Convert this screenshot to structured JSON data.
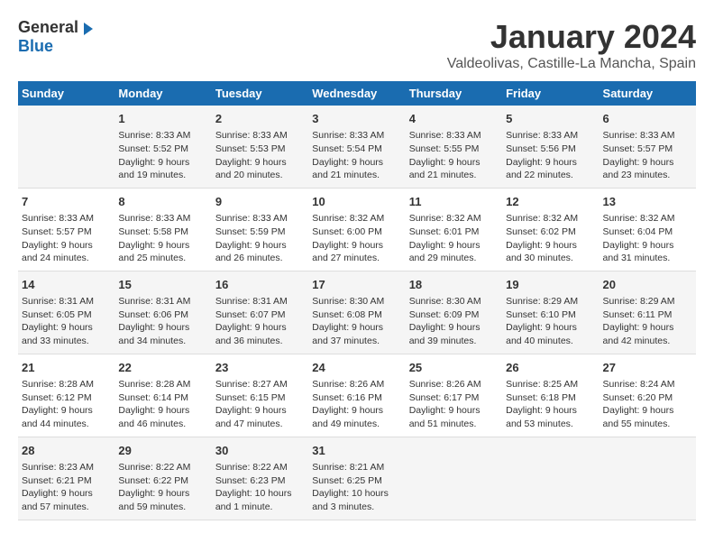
{
  "header": {
    "logo_general": "General",
    "logo_blue": "Blue",
    "month": "January 2024",
    "location": "Valdeolivas, Castille-La Mancha, Spain"
  },
  "days_of_week": [
    "Sunday",
    "Monday",
    "Tuesday",
    "Wednesday",
    "Thursday",
    "Friday",
    "Saturday"
  ],
  "weeks": [
    [
      {
        "day": "",
        "info": ""
      },
      {
        "day": "1",
        "info": "Sunrise: 8:33 AM\nSunset: 5:52 PM\nDaylight: 9 hours\nand 19 minutes."
      },
      {
        "day": "2",
        "info": "Sunrise: 8:33 AM\nSunset: 5:53 PM\nDaylight: 9 hours\nand 20 minutes."
      },
      {
        "day": "3",
        "info": "Sunrise: 8:33 AM\nSunset: 5:54 PM\nDaylight: 9 hours\nand 21 minutes."
      },
      {
        "day": "4",
        "info": "Sunrise: 8:33 AM\nSunset: 5:55 PM\nDaylight: 9 hours\nand 21 minutes."
      },
      {
        "day": "5",
        "info": "Sunrise: 8:33 AM\nSunset: 5:56 PM\nDaylight: 9 hours\nand 22 minutes."
      },
      {
        "day": "6",
        "info": "Sunrise: 8:33 AM\nSunset: 5:57 PM\nDaylight: 9 hours\nand 23 minutes."
      }
    ],
    [
      {
        "day": "7",
        "info": "Sunrise: 8:33 AM\nSunset: 5:57 PM\nDaylight: 9 hours\nand 24 minutes."
      },
      {
        "day": "8",
        "info": "Sunrise: 8:33 AM\nSunset: 5:58 PM\nDaylight: 9 hours\nand 25 minutes."
      },
      {
        "day": "9",
        "info": "Sunrise: 8:33 AM\nSunset: 5:59 PM\nDaylight: 9 hours\nand 26 minutes."
      },
      {
        "day": "10",
        "info": "Sunrise: 8:32 AM\nSunset: 6:00 PM\nDaylight: 9 hours\nand 27 minutes."
      },
      {
        "day": "11",
        "info": "Sunrise: 8:32 AM\nSunset: 6:01 PM\nDaylight: 9 hours\nand 29 minutes."
      },
      {
        "day": "12",
        "info": "Sunrise: 8:32 AM\nSunset: 6:02 PM\nDaylight: 9 hours\nand 30 minutes."
      },
      {
        "day": "13",
        "info": "Sunrise: 8:32 AM\nSunset: 6:04 PM\nDaylight: 9 hours\nand 31 minutes."
      }
    ],
    [
      {
        "day": "14",
        "info": "Sunrise: 8:31 AM\nSunset: 6:05 PM\nDaylight: 9 hours\nand 33 minutes."
      },
      {
        "day": "15",
        "info": "Sunrise: 8:31 AM\nSunset: 6:06 PM\nDaylight: 9 hours\nand 34 minutes."
      },
      {
        "day": "16",
        "info": "Sunrise: 8:31 AM\nSunset: 6:07 PM\nDaylight: 9 hours\nand 36 minutes."
      },
      {
        "day": "17",
        "info": "Sunrise: 8:30 AM\nSunset: 6:08 PM\nDaylight: 9 hours\nand 37 minutes."
      },
      {
        "day": "18",
        "info": "Sunrise: 8:30 AM\nSunset: 6:09 PM\nDaylight: 9 hours\nand 39 minutes."
      },
      {
        "day": "19",
        "info": "Sunrise: 8:29 AM\nSunset: 6:10 PM\nDaylight: 9 hours\nand 40 minutes."
      },
      {
        "day": "20",
        "info": "Sunrise: 8:29 AM\nSunset: 6:11 PM\nDaylight: 9 hours\nand 42 minutes."
      }
    ],
    [
      {
        "day": "21",
        "info": "Sunrise: 8:28 AM\nSunset: 6:12 PM\nDaylight: 9 hours\nand 44 minutes."
      },
      {
        "day": "22",
        "info": "Sunrise: 8:28 AM\nSunset: 6:14 PM\nDaylight: 9 hours\nand 46 minutes."
      },
      {
        "day": "23",
        "info": "Sunrise: 8:27 AM\nSunset: 6:15 PM\nDaylight: 9 hours\nand 47 minutes."
      },
      {
        "day": "24",
        "info": "Sunrise: 8:26 AM\nSunset: 6:16 PM\nDaylight: 9 hours\nand 49 minutes."
      },
      {
        "day": "25",
        "info": "Sunrise: 8:26 AM\nSunset: 6:17 PM\nDaylight: 9 hours\nand 51 minutes."
      },
      {
        "day": "26",
        "info": "Sunrise: 8:25 AM\nSunset: 6:18 PM\nDaylight: 9 hours\nand 53 minutes."
      },
      {
        "day": "27",
        "info": "Sunrise: 8:24 AM\nSunset: 6:20 PM\nDaylight: 9 hours\nand 55 minutes."
      }
    ],
    [
      {
        "day": "28",
        "info": "Sunrise: 8:23 AM\nSunset: 6:21 PM\nDaylight: 9 hours\nand 57 minutes."
      },
      {
        "day": "29",
        "info": "Sunrise: 8:22 AM\nSunset: 6:22 PM\nDaylight: 9 hours\nand 59 minutes."
      },
      {
        "day": "30",
        "info": "Sunrise: 8:22 AM\nSunset: 6:23 PM\nDaylight: 10 hours\nand 1 minute."
      },
      {
        "day": "31",
        "info": "Sunrise: 8:21 AM\nSunset: 6:25 PM\nDaylight: 10 hours\nand 3 minutes."
      },
      {
        "day": "",
        "info": ""
      },
      {
        "day": "",
        "info": ""
      },
      {
        "day": "",
        "info": ""
      }
    ]
  ]
}
